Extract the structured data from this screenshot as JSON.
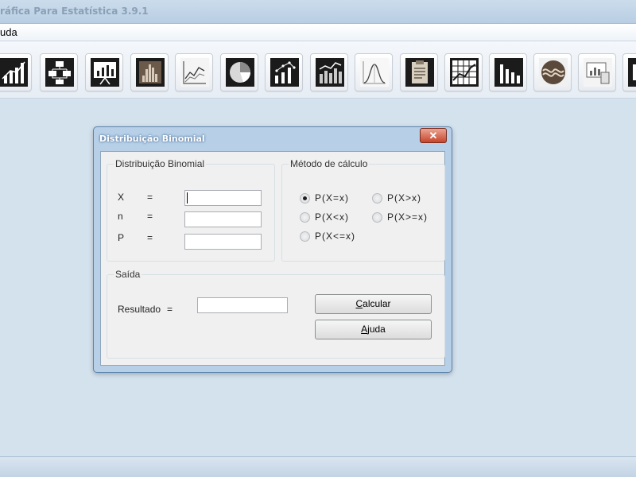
{
  "window": {
    "title": "ráfica Para Estatística 3.9.1"
  },
  "menu": {
    "items": [
      "uda"
    ]
  },
  "toolbar": {
    "icons": [
      "line-chart-icon",
      "flowchart-icon",
      "slide-chart-icon",
      "histogram-icon",
      "line-graph-icon",
      "pie-chart-icon",
      "scatter-plot-icon",
      "bar-line-chart-icon",
      "normal-curve-icon",
      "clipboard-icon",
      "grid-chart-icon",
      "column-chart-icon",
      "wave-icon",
      "presentation-icon",
      "partial-icon"
    ]
  },
  "dialog": {
    "title": "Distribuição Binomial",
    "close_label": "✕",
    "group_binomial": {
      "legend": "Distribuição Binomial",
      "rows": [
        {
          "label": "X",
          "eq": "=",
          "value": ""
        },
        {
          "label": "n",
          "eq": "=",
          "value": ""
        },
        {
          "label": "P",
          "eq": "=",
          "value": ""
        }
      ]
    },
    "group_method": {
      "legend": "Método de cálculo",
      "options": [
        {
          "label": "P(X=x)",
          "checked": true
        },
        {
          "label": "P(X>x)",
          "checked": false
        },
        {
          "label": "P(X<x)",
          "checked": false
        },
        {
          "label": "P(X>=x)",
          "checked": false
        },
        {
          "label": "P(X<=x)",
          "checked": false
        }
      ]
    },
    "group_output": {
      "legend": "Saída",
      "result_label": "Resultado",
      "result_eq": "=",
      "result_value": ""
    },
    "buttons": {
      "calculate": {
        "prefix": "",
        "accel": "C",
        "rest": "alcular"
      },
      "help": {
        "prefix": "",
        "accel": "A",
        "rest": "juda"
      }
    }
  }
}
